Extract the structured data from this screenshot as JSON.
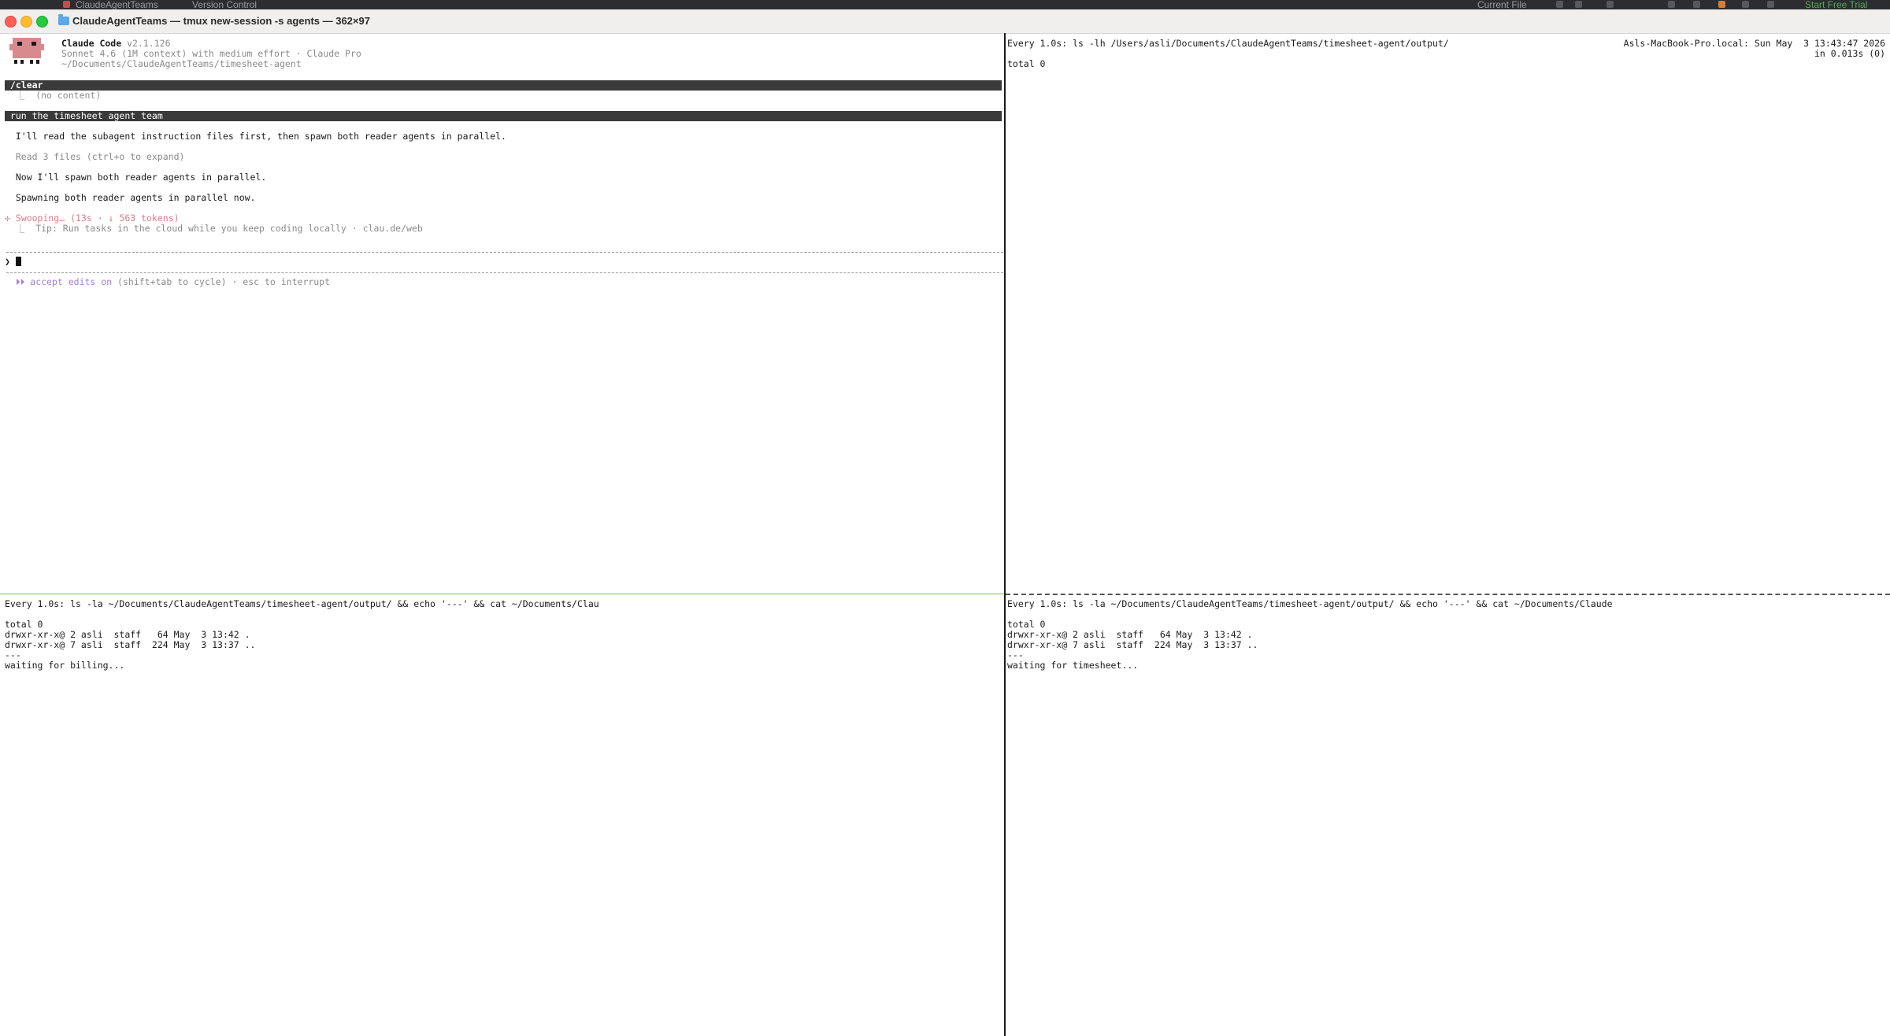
{
  "ide": {
    "project": "ClaudeAgentTeams",
    "vcs": "Version Control",
    "current_file": "Current File",
    "trial": "Start Free Trial"
  },
  "window": {
    "title": "ClaudeAgentTeams — tmux new-session -s agents — 362×97"
  },
  "claude": {
    "name": "Claude Code",
    "version": "v2.1.126",
    "model_line": "Sonnet 4.6 (1M context) with medium effort · Claude Pro",
    "path": "~/Documents/ClaudeAgentTeams/timesheet-agent",
    "cmd_clear": " /clear",
    "clear_result": "  ⎿  (no content)",
    "cmd_run": " run the timesheet agent team",
    "msg1": "  I'll read the subagent instruction files first, then spawn both reader agents in parallel.",
    "read_files": "  Read 3 files (ctrl+o to expand)",
    "msg2": "  Now I'll spawn both reader agents in parallel.",
    "msg3": "  Spawning both reader agents in parallel now.",
    "status": "✢ Swooping… (13s · ↓ 563 tokens)",
    "tip": "  ⎿  Tip: Run tasks in the cloud while you keep coding locally · clau.de/web",
    "prompt": "❯ ",
    "footer_accept": "  ⏵⏵ accept edits on",
    "footer_rest": " (shift+tab to cycle) · esc to interrupt"
  },
  "pane_tr": {
    "header": "Every 1.0s: ls -lh /Users/asli/Documents/ClaudeAgentTeams/timesheet-agent/output/",
    "host": "Asls-MacBook-Pro.local: Sun May  3 13:43:47 2026",
    "timing": "in 0.013s (0)",
    "line1": "total 0"
  },
  "pane_bl": {
    "header": "Every 1.0s: ls -la ~/Documents/ClaudeAgentTeams/timesheet-agent/output/ && echo '---' && cat ~/Documents/Clau",
    "lines": [
      "total 0",
      "drwxr-xr-x@ 2 asli  staff   64 May  3 13:42 .",
      "drwxr-xr-x@ 7 asli  staff  224 May  3 13:37 ..",
      "---",
      "waiting for billing..."
    ]
  },
  "pane_br": {
    "header": "Every 1.0s: ls -la ~/Documents/ClaudeAgentTeams/timesheet-agent/output/ && echo '---' && cat ~/Documents/Claude",
    "lines": [
      "total 0",
      "drwxr-xr-x@ 2 asli  staff   64 May  3 13:42 .",
      "drwxr-xr-x@ 7 asli  staff  224 May  3 13:37 ..",
      "---",
      "waiting for timesheet..."
    ]
  }
}
